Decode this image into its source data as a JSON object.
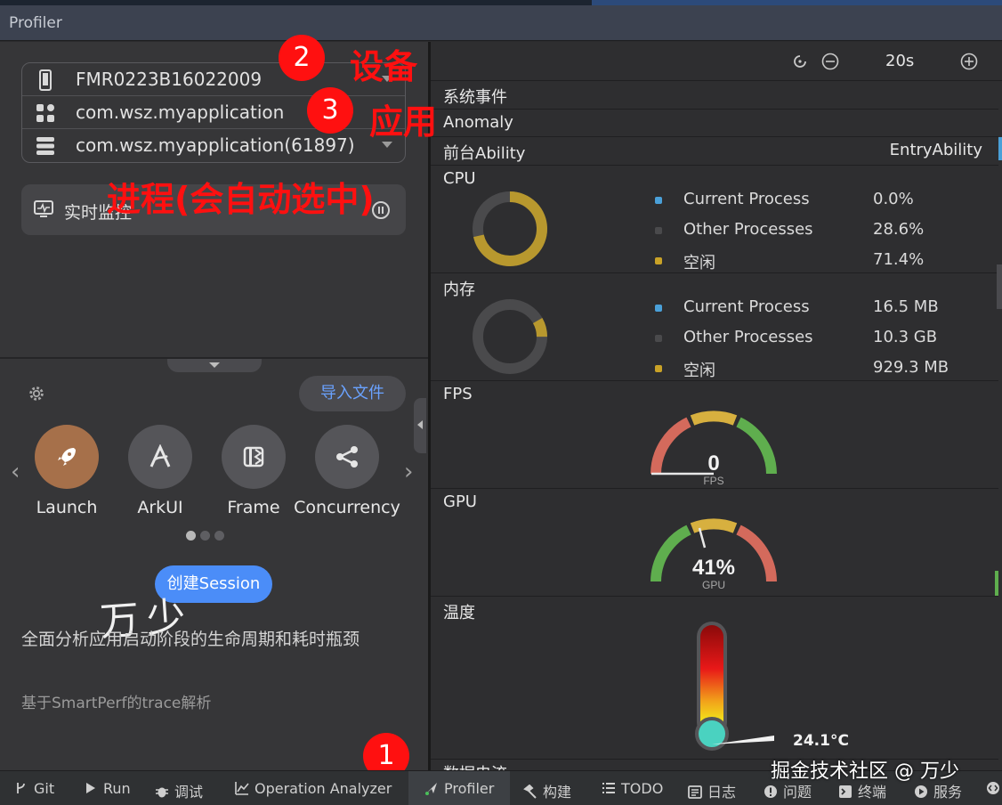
{
  "window": {
    "title": "Profiler"
  },
  "selectors": {
    "device": {
      "icon": "phone-icon",
      "value": "FMR0223B16022009"
    },
    "app": {
      "icon": "apps-grid-icon",
      "value": "com.wsz.myapplication"
    },
    "process": {
      "icon": "process-list-icon",
      "value": "com.wsz.myapplication(61897)"
    }
  },
  "realtime": {
    "label": "实时监控",
    "icon": "monitor-icon",
    "action_icon": "pause-icon"
  },
  "annotations": {
    "badge1": "1",
    "badge2": "2",
    "badge3": "3",
    "device_label": "设备",
    "app_label": "应用",
    "process_label": "进程(会自动选中)",
    "color": "#ff1010"
  },
  "templates": {
    "import_button": "导入文件",
    "items": [
      {
        "label": "Launch",
        "icon": "rocket-icon",
        "selected": true
      },
      {
        "label": "ArkUI",
        "icon": "arkui-icon",
        "selected": false
      },
      {
        "label": "Frame",
        "icon": "frame-icon",
        "selected": false
      },
      {
        "label": "Concurrency",
        "icon": "concurrency-icon",
        "selected": false
      }
    ],
    "page_index": 1,
    "page_count": 3,
    "create_button": "创建Session",
    "description": "全面分析应用启动阶段的生命周期和耗时瓶颈",
    "subtitle": "基于SmartPerf的trace解析",
    "signature": "万少"
  },
  "toolbar": {
    "time_window": "20s"
  },
  "monitor": {
    "system_events": "系统事件",
    "anomaly": "Anomaly",
    "foreground_label": "前台Ability",
    "foreground_value": "EntryAbility",
    "cpu": {
      "title": "CPU",
      "legend": [
        {
          "name": "Current Process",
          "value": "0.0%",
          "color": "#4aa0d8"
        },
        {
          "name": "Other Processes",
          "value": "28.6%",
          "color": "#4a4a4c"
        },
        {
          "name": "空闲",
          "value": "71.4%",
          "color": "#c9a227"
        }
      ]
    },
    "memory": {
      "title": "内存",
      "legend": [
        {
          "name": "Current Process",
          "value": "16.5 MB",
          "color": "#4aa0d8"
        },
        {
          "name": "Other Processes",
          "value": "10.3 GB",
          "color": "#4a4a4c"
        },
        {
          "name": "空闲",
          "value": "929.3 MB",
          "color": "#c9a227"
        }
      ]
    },
    "fps": {
      "title": "FPS",
      "value": "0",
      "unit": "FPS"
    },
    "gpu": {
      "title": "GPU",
      "value": "41%",
      "unit": "GPU"
    },
    "temperature": {
      "title": "温度",
      "value": "24.1°C"
    },
    "next_section": "数据电流"
  },
  "bottombar": {
    "items": [
      "Git",
      "Run",
      "调试",
      "Operation Analyzer",
      "Profiler",
      "构建",
      "TODO",
      "日志",
      "问题",
      "终端",
      "服务"
    ],
    "active": "Profiler"
  },
  "watermark": "掘金技术社区 @ 万少"
}
